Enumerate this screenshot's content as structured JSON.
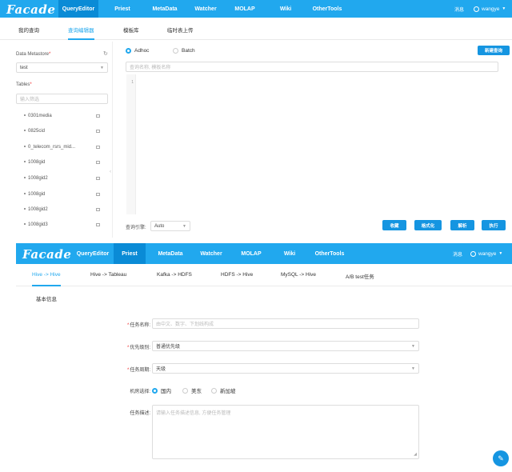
{
  "app": {
    "logo": "Facade"
  },
  "panel1": {
    "nav": [
      "QueryEditor",
      "Priest",
      "MetaData",
      "Watcher",
      "MOLAP",
      "Wiki",
      "OtherTools"
    ],
    "messages": "消息",
    "user": "wangye",
    "subtabs": [
      "我的查询",
      "查询编辑器",
      "模板库",
      "临时表上传"
    ],
    "active_subtab": 1,
    "sidebar": {
      "metastore_label": "Data Metastore",
      "metastore_value": "test",
      "tables_label": "Tables",
      "filter_placeholder": "输入筛选",
      "tables": [
        "0301media",
        "0825cid",
        "0_telecom_rsrs_mid...",
        "1008gid",
        "1008gid2",
        "1008gid",
        "1008gid2",
        "1008gid3"
      ]
    },
    "modes": [
      "Adhoc",
      "Batch"
    ],
    "new_query_button": "新建查询",
    "query_name_placeholder": "查询名称, 模板名称",
    "editor": {
      "line_numbers": [
        "1"
      ]
    },
    "engine_label": "查询引擎:",
    "engine_value": "Auto",
    "actions": [
      "收藏",
      "格式化",
      "解析",
      "执行"
    ]
  },
  "panel2": {
    "nav": [
      "QueryEditor",
      "Priest",
      "MetaData",
      "Watcher",
      "MOLAP",
      "Wiki",
      "OtherTools"
    ],
    "messages": "消息",
    "user": "wangye",
    "subtabs": [
      "Hive -> Hive",
      "Hive -> Tableau",
      "Kafka -> HDFS",
      "HDFS -> Hive",
      "MySQL -> Hive",
      "A/B test任务"
    ],
    "active_subtab": 0,
    "section_title": "基本信息",
    "form": {
      "task_name_label": "任务名称:",
      "task_name_placeholder": "由中文、数字、下划线构成",
      "priority_label": "优先级别:",
      "priority_value": "普通优先级",
      "cycle_label": "任务周期:",
      "cycle_value": "天级",
      "room_label": "机房选择:",
      "room_options": [
        "国内",
        "美东",
        "新加坡"
      ],
      "desc_label": "任务描述:",
      "desc_placeholder": "请输入任务描述信息, 方便任务管理"
    },
    "fab_icon": "edit-icon"
  }
}
